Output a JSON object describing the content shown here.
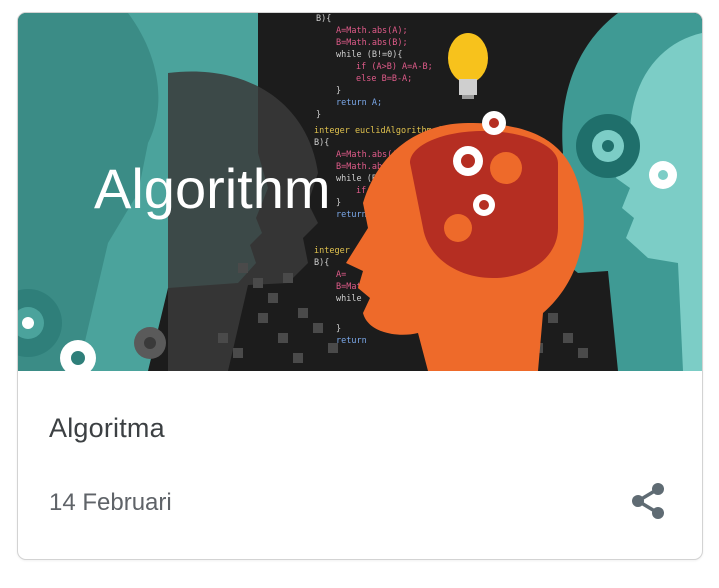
{
  "card": {
    "image_overlay_text": "Algorithm",
    "title": "Algoritma",
    "date": "14 Februari",
    "share_icon": "share-icon"
  },
  "code_lines": [
    "B){",
    "A=Math.abs(A);",
    "B=Math.abs(B);",
    "while (B!=0){",
    "if (A>B) A=A-B;",
    "else B=B-A;",
    "}",
    "return A;",
    "}",
    "integer euclidAlgorithm (int A, int",
    "B){",
    "A=Math.abs(A);",
    "B=Math.abs(B);",
    "while (B!=0){",
    "if",
    "}",
    "return",
    "integer eu",
    "B){",
    "A=",
    "B=Math",
    "while",
    "}",
    "return"
  ],
  "colors": {
    "teal_dark": "#2f7f7a",
    "teal_mid": "#4aa39b",
    "teal_light": "#7fcfc8",
    "orange": "#ee6a2a",
    "red_brain": "#b52e22",
    "bulb": "#f7c21c",
    "text_title": "#3c4043",
    "text_date": "#5f6368"
  }
}
